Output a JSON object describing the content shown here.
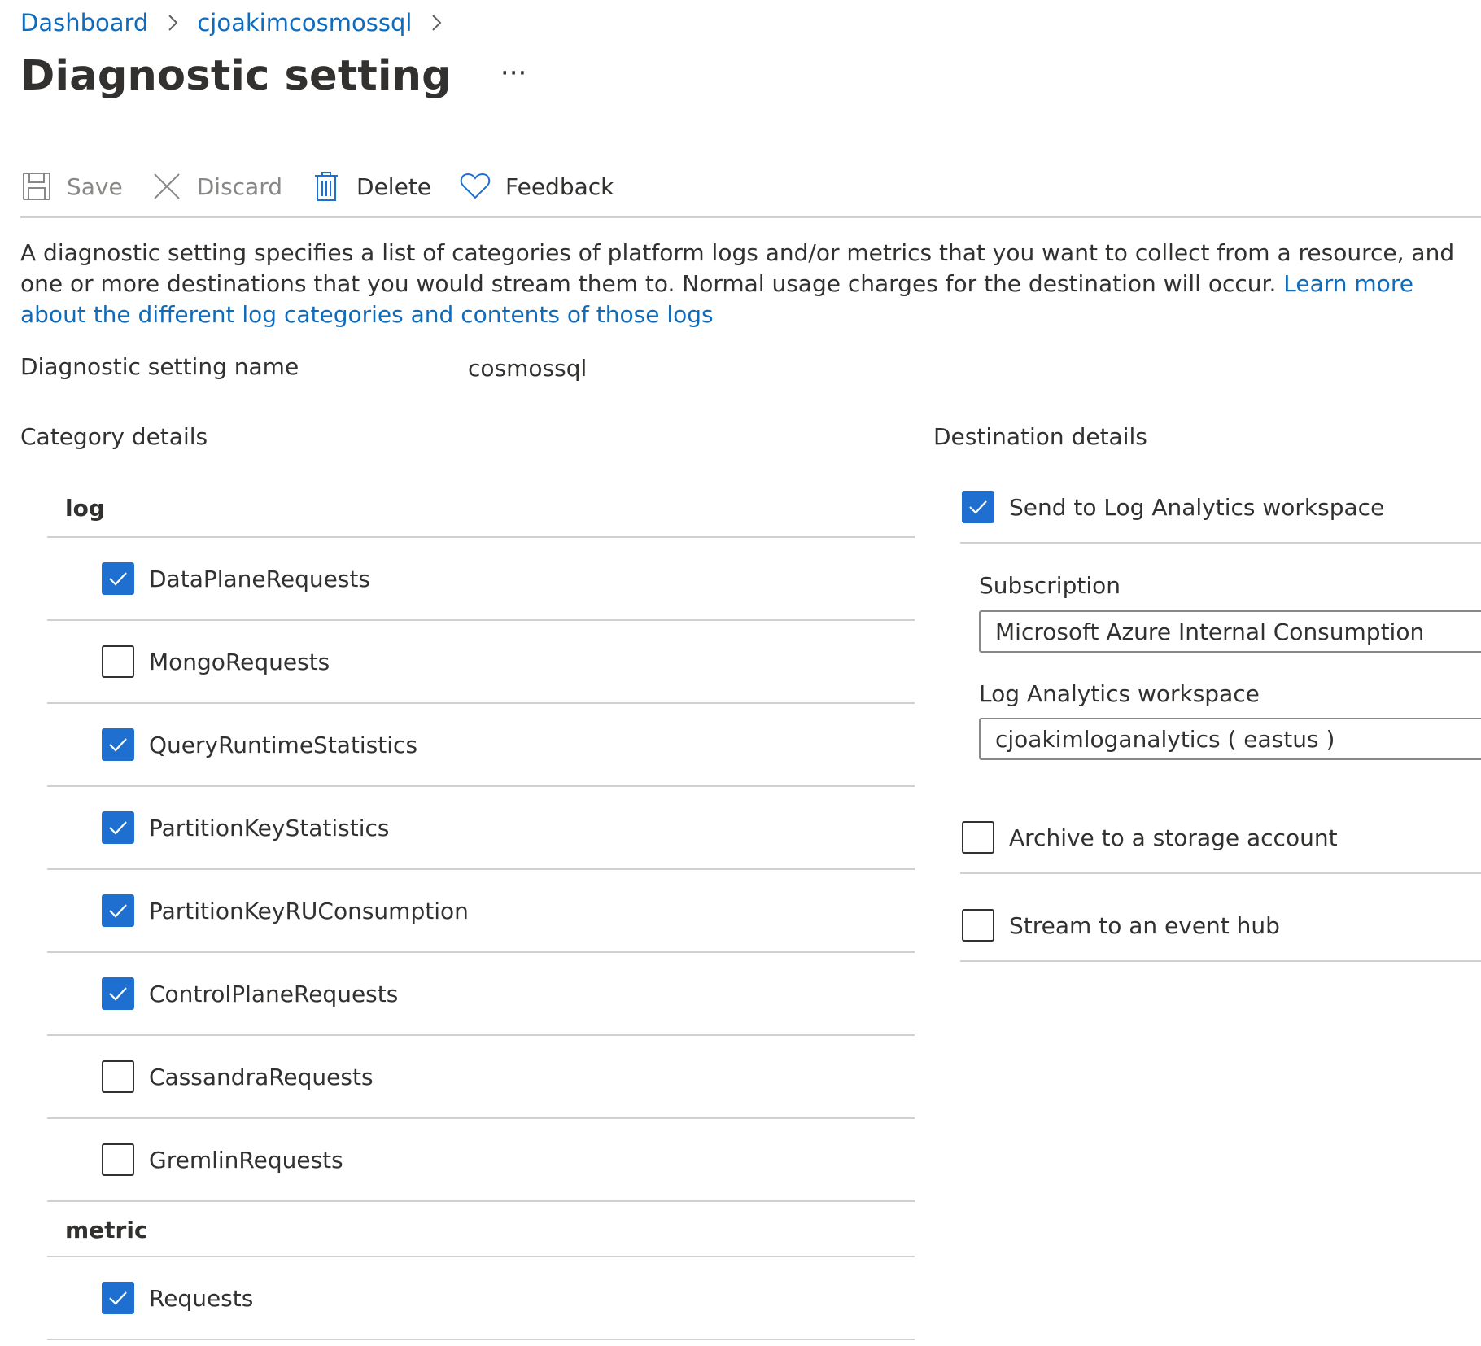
{
  "breadcrumb": {
    "items": [
      "Dashboard",
      "cjoakimcosmossql"
    ]
  },
  "header": {
    "title": "Diagnostic setting",
    "more_label": "···"
  },
  "toolbar": {
    "save_label": "Save",
    "discard_label": "Discard",
    "delete_label": "Delete",
    "feedback_label": "Feedback"
  },
  "description": {
    "text": "A diagnostic setting specifies a list of categories of platform logs and/or metrics that you want to collect from a resource, and one or more destinations that you would stream them to. Normal usage charges for the destination will occur. ",
    "link": "Learn more about the different log categories and contents of those logs"
  },
  "setting_name": {
    "label": "Diagnostic setting name",
    "value": "cosmossql"
  },
  "category_details": {
    "title": "Category details",
    "log_header": "log",
    "logs": [
      {
        "label": "DataPlaneRequests",
        "checked": true
      },
      {
        "label": "MongoRequests",
        "checked": false
      },
      {
        "label": "QueryRuntimeStatistics",
        "checked": true
      },
      {
        "label": "PartitionKeyStatistics",
        "checked": true
      },
      {
        "label": "PartitionKeyRUConsumption",
        "checked": true
      },
      {
        "label": "ControlPlaneRequests",
        "checked": true
      },
      {
        "label": "CassandraRequests",
        "checked": false
      },
      {
        "label": "GremlinRequests",
        "checked": false
      }
    ],
    "metric_header": "metric",
    "metrics": [
      {
        "label": "Requests",
        "checked": true
      }
    ]
  },
  "destination_details": {
    "title": "Destination details",
    "log_analytics": {
      "label": "Send to Log Analytics workspace",
      "checked": true
    },
    "subscription_label": "Subscription",
    "subscription_value": "Microsoft Azure Internal Consumption",
    "workspace_label": "Log Analytics workspace",
    "workspace_value": "cjoakimloganalytics ( eastus )",
    "storage": {
      "label": "Archive to a storage account",
      "checked": false
    },
    "event_hub": {
      "label": "Stream to an event hub",
      "checked": false
    }
  },
  "colors": {
    "accent": "#1f6fd1",
    "link": "#0f6cbd",
    "divider": "#d2d0ce",
    "text": "#323130",
    "disabled": "#8a8886"
  }
}
